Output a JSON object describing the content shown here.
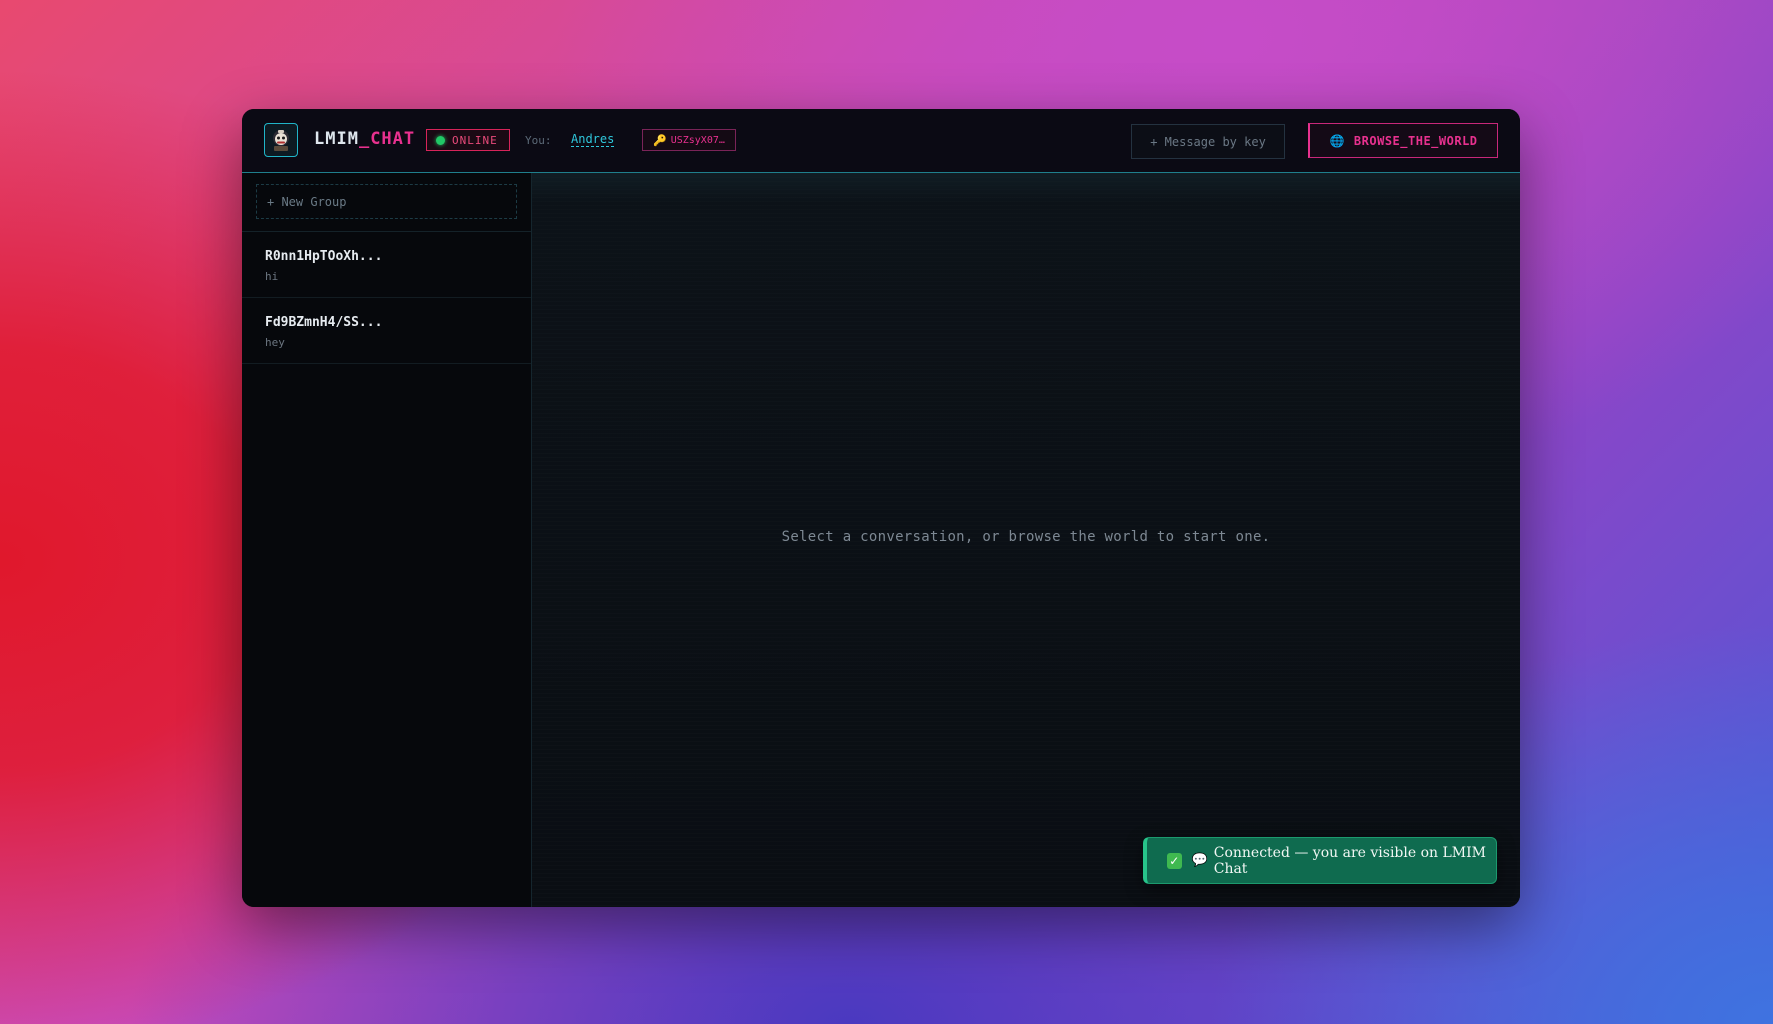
{
  "header": {
    "brand_prefix": "LMIM",
    "brand_suffix": "_CHAT",
    "status": "ONLINE",
    "you_label": "You:",
    "user_name": "Andres",
    "key_short": "USZsyX07…",
    "message_by_key_label": "+ Message by key",
    "browse_label": "BROWSE_THE_WORLD"
  },
  "sidebar": {
    "new_group_label": "+ New Group",
    "conversations": [
      {
        "title": "R0nn1HpTOoXh...",
        "preview": "hi"
      },
      {
        "title": "Fd9BZmnH4/SS...",
        "preview": "hey"
      }
    ]
  },
  "main": {
    "empty_state": "Select a conversation, or browse the world to start one."
  },
  "toast": {
    "message": "Connected — you are visible on LMIM Chat"
  },
  "colors": {
    "accent_pink": "#e8318f",
    "accent_cyan": "#2fc7db",
    "online_green": "#21c766",
    "toast_bg": "#0f6b4f"
  },
  "icons": {
    "logo": "robot-avatar-icon",
    "status": "status-dot-icon",
    "key": "key-icon",
    "browse": "globe-icon",
    "toast_check": "check-icon",
    "toast_bubble": "speech-bubble-icon"
  }
}
